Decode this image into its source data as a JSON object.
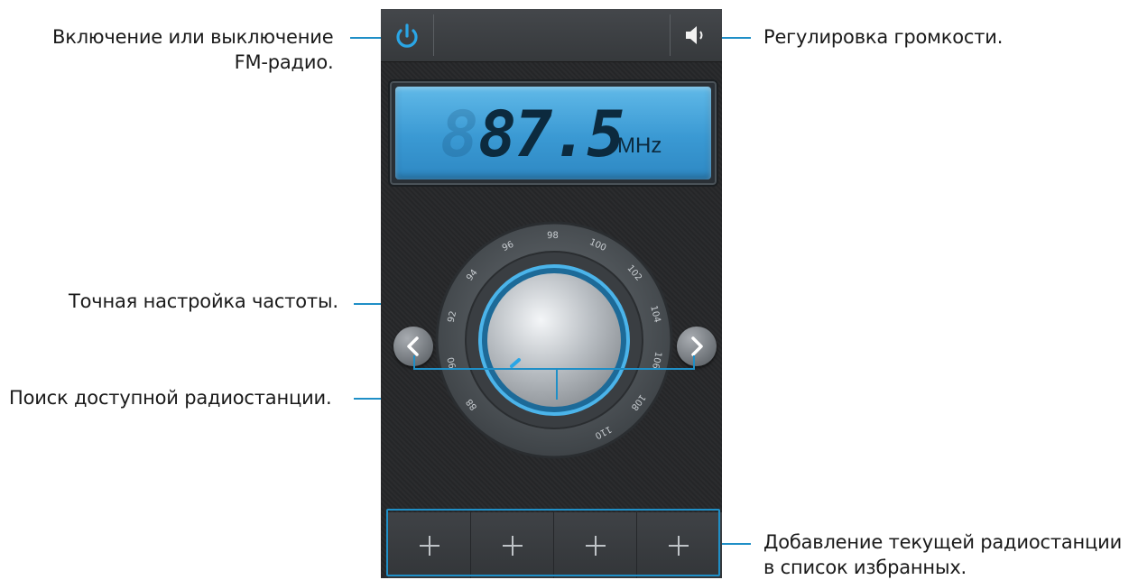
{
  "annotations": {
    "power": [
      "Включение или выключение",
      "FM-радио."
    ],
    "volume": "Регулировка громкости.",
    "fine_tune": "Точная настройка частоты.",
    "search": "Поиск доступной радиостанции.",
    "favorites": [
      "Добавление текущей радиостанции",
      "в список избранных."
    ]
  },
  "display": {
    "ghost_digit": "8",
    "frequency": "87.5",
    "unit": "MHz"
  },
  "dial": {
    "scale_labels": [
      "88",
      "90",
      "92",
      "94",
      "96",
      "98",
      "100",
      "102",
      "104",
      "106",
      "108",
      "110"
    ]
  },
  "icons": {
    "power": "power-icon",
    "volume": "speaker-icon",
    "prev": "chevron-left-icon",
    "next": "chevron-right-icon",
    "favorite": "plus-icon"
  },
  "colors": {
    "accent": "#1f8fc7",
    "lcd": "#3a99d3"
  }
}
